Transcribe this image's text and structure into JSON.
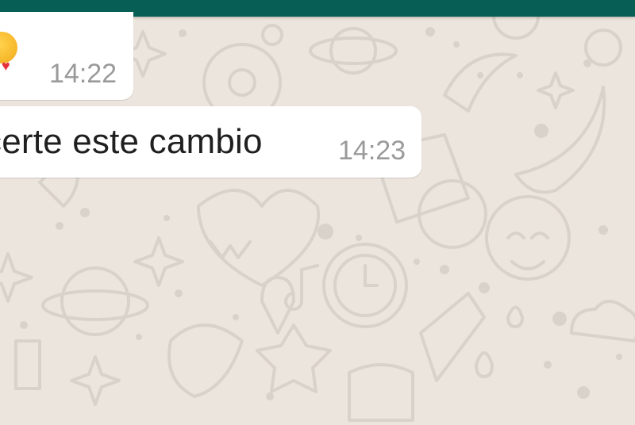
{
  "colors": {
    "header": "#075e54",
    "chat_background": "#ece5dd",
    "bubble": "#ffffff",
    "message_text": "#1f1f1f",
    "timestamp_text": "#9a9a9a",
    "wallpaper_doodle": "#d9d2ca"
  },
  "messages": [
    {
      "text": "",
      "emoji": "smiling-face-with-hearts-emoji",
      "time": "14:22"
    },
    {
      "text": "certe este cambio",
      "time": "14:23"
    }
  ]
}
